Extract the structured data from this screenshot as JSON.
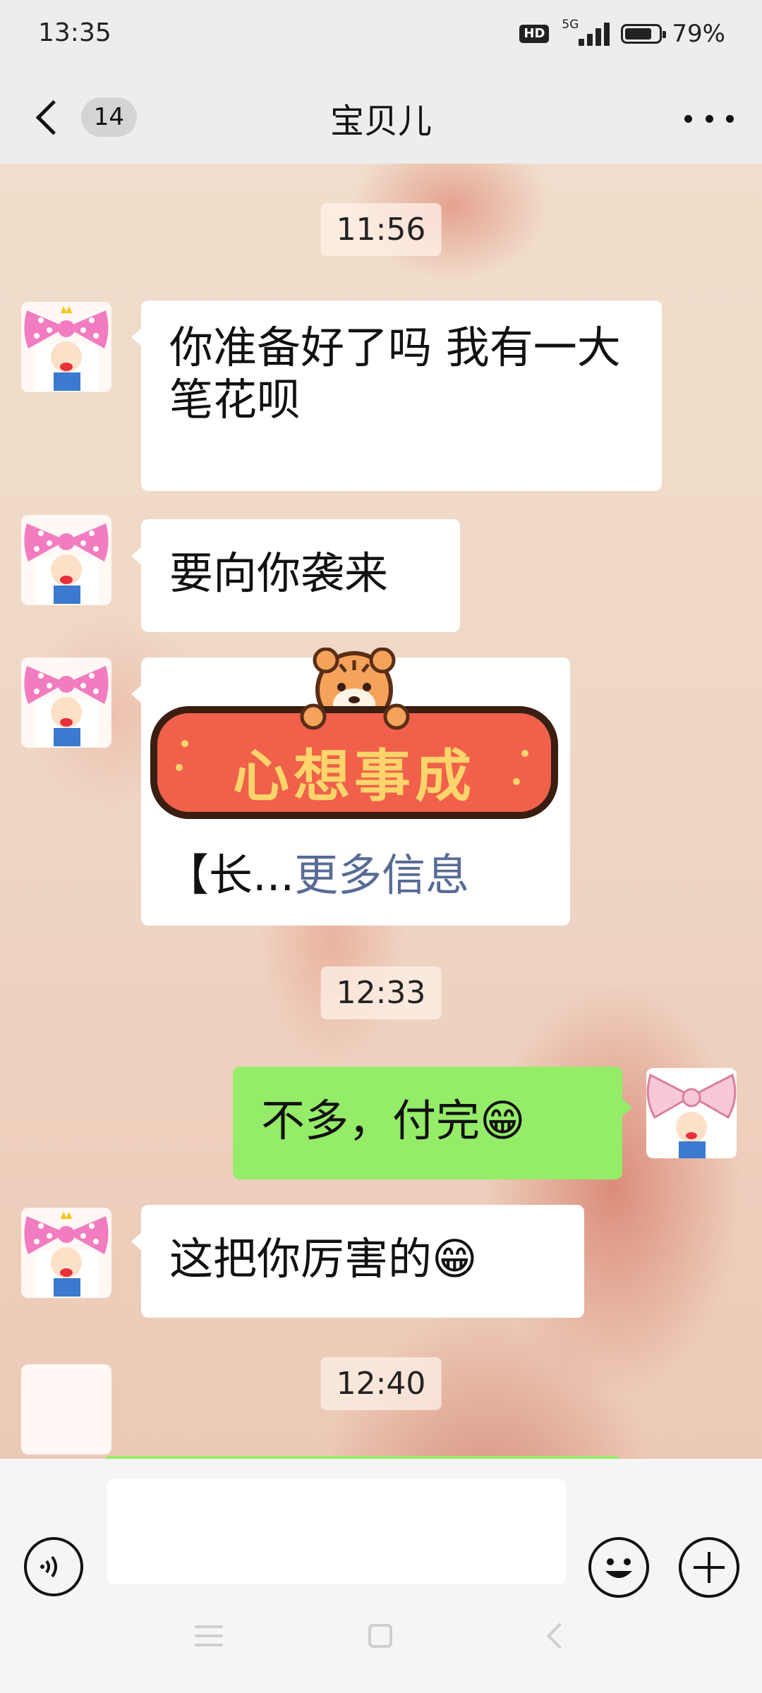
{
  "status_bar": {
    "time": "13:35",
    "hd_label": "HD",
    "network": "5G",
    "battery_percent": "79%",
    "battery_level": 0.79
  },
  "header": {
    "unread_count": "14",
    "title": "宝贝儿",
    "back_icon": "chevron-left-icon",
    "more_icon": "more-dots-icon"
  },
  "chat": {
    "timestamps": [
      "11:56",
      "12:33",
      "12:40"
    ],
    "messages": [
      {
        "side": "in",
        "text": "你准备好了吗 我有一大笔花呗"
      },
      {
        "side": "in",
        "text": "要向你袭来"
      },
      {
        "side": "in",
        "type": "link-card",
        "preview": "【长...",
        "more_label": "更多信息"
      },
      {
        "side": "out",
        "text": "不多，付完😁"
      },
      {
        "side": "in",
        "text": "这把你厉害的😁"
      }
    ],
    "sticker_text": "心想事成"
  },
  "input_bar": {
    "voice_icon": "voice-icon",
    "input_value": "",
    "emoji_icon": "emoji-icon",
    "plus_icon": "plus-icon"
  },
  "colors": {
    "incoming_bubble": "#ffffff",
    "outgoing_bubble": "#95ec69",
    "link_color": "#576b95",
    "sticker_red": "#f0604a"
  }
}
